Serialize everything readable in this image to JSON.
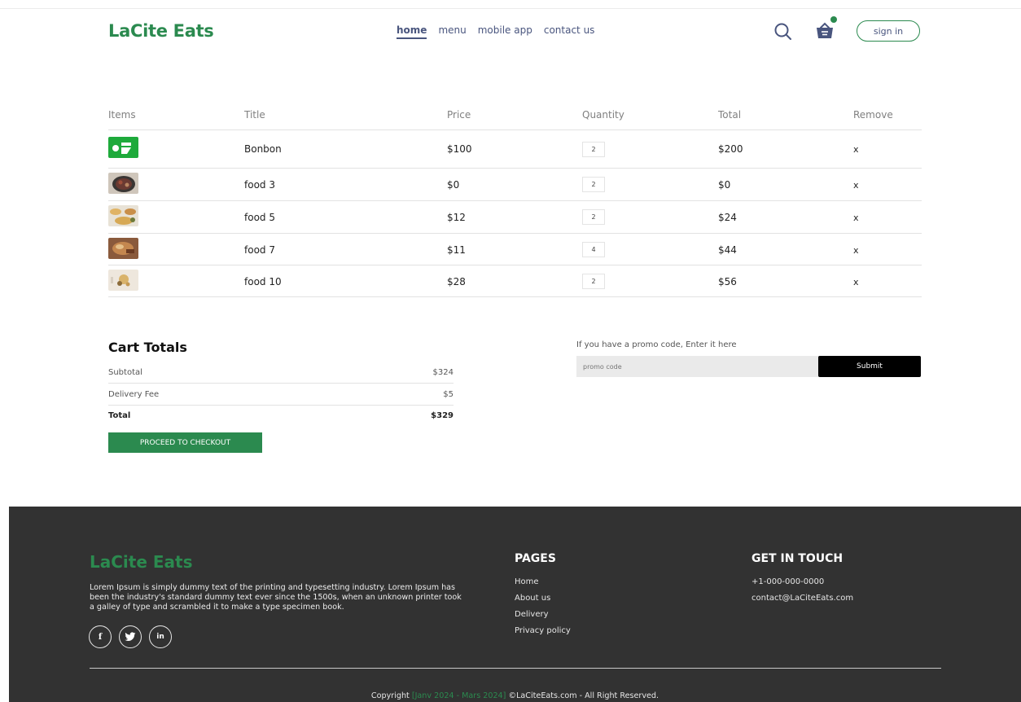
{
  "brand": {
    "name": "LaCite Eats",
    "accent": "#2b8a4f",
    "nav_color": "#49557e"
  },
  "nav": {
    "items": [
      "home",
      "menu",
      "mobile app",
      "contact us"
    ],
    "active": "home"
  },
  "header": {
    "search_icon": "search-icon",
    "basket_icon": "basket-icon",
    "signin_label": "sign in"
  },
  "cart": {
    "headers": {
      "items": "Items",
      "title": "Title",
      "price": "Price",
      "quantity": "Quantity",
      "total": "Total",
      "remove": "Remove"
    },
    "rows": [
      {
        "title": "Bonbon",
        "price": "$100",
        "quantity": "2",
        "total": "$200",
        "remove": "x"
      },
      {
        "title": "food 3",
        "price": "$0",
        "quantity": "2",
        "total": "$0",
        "remove": "x"
      },
      {
        "title": "food 5",
        "price": "$12",
        "quantity": "2",
        "total": "$24",
        "remove": "x"
      },
      {
        "title": "food 7",
        "price": "$11",
        "quantity": "4",
        "total": "$44",
        "remove": "x"
      },
      {
        "title": "food 10",
        "price": "$28",
        "quantity": "2",
        "total": "$56",
        "remove": "x"
      }
    ]
  },
  "totals": {
    "title": "Cart Totals",
    "subtotal_label": "Subtotal",
    "subtotal_value": "$324",
    "delivery_label": "Delivery Fee",
    "delivery_value": "$5",
    "total_label": "Total",
    "total_value": "$329",
    "checkout_label": "PROCEED TO CHECKOUT"
  },
  "promo": {
    "label": "If you have a promo code, Enter it here",
    "placeholder": "promo code",
    "submit_label": "Submit"
  },
  "footer": {
    "brand": "LaCite Eats",
    "description": "Lorem Ipsum is simply dummy text of the printing and typesetting industry. Lorem Ipsum has been the industry's standard dummy text ever since the 1500s, when an unknown printer took a galley of type and scrambled it to make a type specimen book.",
    "socials": [
      "f",
      "t",
      "in"
    ],
    "pages_heading": "PAGES",
    "pages": [
      "Home",
      "About us",
      "Delivery",
      "Privacy policy"
    ],
    "contact_heading": "GET IN TOUCH",
    "phone": "+1-000-000-0000",
    "email": "contact@LaCiteEats.com",
    "copyright_prefix": "Copyright",
    "copyright_dates": "[Janv 2024 - Mars 2024]",
    "copyright_suffix": "©LaCiteEats.com - All Right Reserved."
  }
}
